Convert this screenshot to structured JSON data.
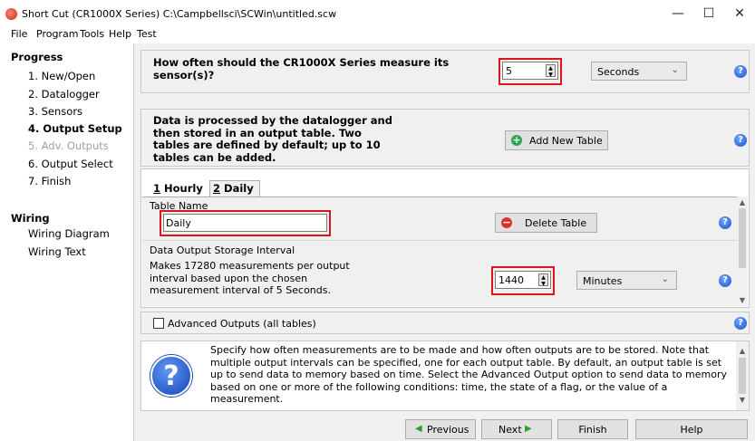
{
  "window": {
    "title": "Short Cut (CR1000X Series) C:\\Campbellsci\\SCWin\\untitled.scw",
    "minimize_glyph": "—",
    "maximize_glyph": "☐",
    "close_glyph": "✕"
  },
  "menu": {
    "file": "File",
    "program": "Program",
    "tools": "Tools",
    "help": "Help",
    "test": "Test"
  },
  "sidebar": {
    "progress_heading": "Progress",
    "steps": [
      "1. New/Open",
      "2. Datalogger",
      "3. Sensors",
      "4. Output Setup",
      "5. Adv. Outputs",
      "6. Output Select",
      "7. Finish"
    ],
    "wiring_heading": "Wiring",
    "wiring_items": [
      "Wiring Diagram",
      "Wiring Text"
    ]
  },
  "measure": {
    "question": "How often should the CR1000X Series measure its sensor(s)?",
    "value": "5",
    "unit": "Seconds"
  },
  "tables_info": {
    "text": "Data is processed by the datalogger and then stored in an output table. Two tables are defined by default; up to 10 tables can be added.",
    "add_button": "Add New Table"
  },
  "tabs": [
    {
      "num": "1",
      "label": "Hourly"
    },
    {
      "num": "2",
      "label": "Daily"
    }
  ],
  "table_settings": {
    "name_label": "Table Name",
    "name_value": "Daily",
    "delete_button": "Delete Table",
    "interval_group_label": "Data Output Storage Interval",
    "interval_description": "Makes 17280 measurements per output interval based upon the chosen measurement interval of 5 Seconds.",
    "interval_value": "1440",
    "interval_unit": "Minutes"
  },
  "advanced": {
    "label": "Advanced Outputs (all tables)"
  },
  "help_text": "Specify how often measurements are to be made and how often outputs are to be stored. Note that multiple output intervals can be specified, one for each output table. By default, an output table is set up to send data to memory based on time. Select the Advanced Output option to send data to memory based on one or more of the following conditions: time, the state of a flag, or the value of a measurement.",
  "nav": {
    "previous": "Previous",
    "next": "Next",
    "finish": "Finish",
    "help": "Help"
  },
  "colors": {
    "highlight_box": "#e0141a",
    "help_icon_blue": "#1a52c8",
    "add_icon_green": "#2ea44f",
    "delete_icon_red": "#d9342b",
    "nav_arrow_green": "#2e9e2e"
  }
}
